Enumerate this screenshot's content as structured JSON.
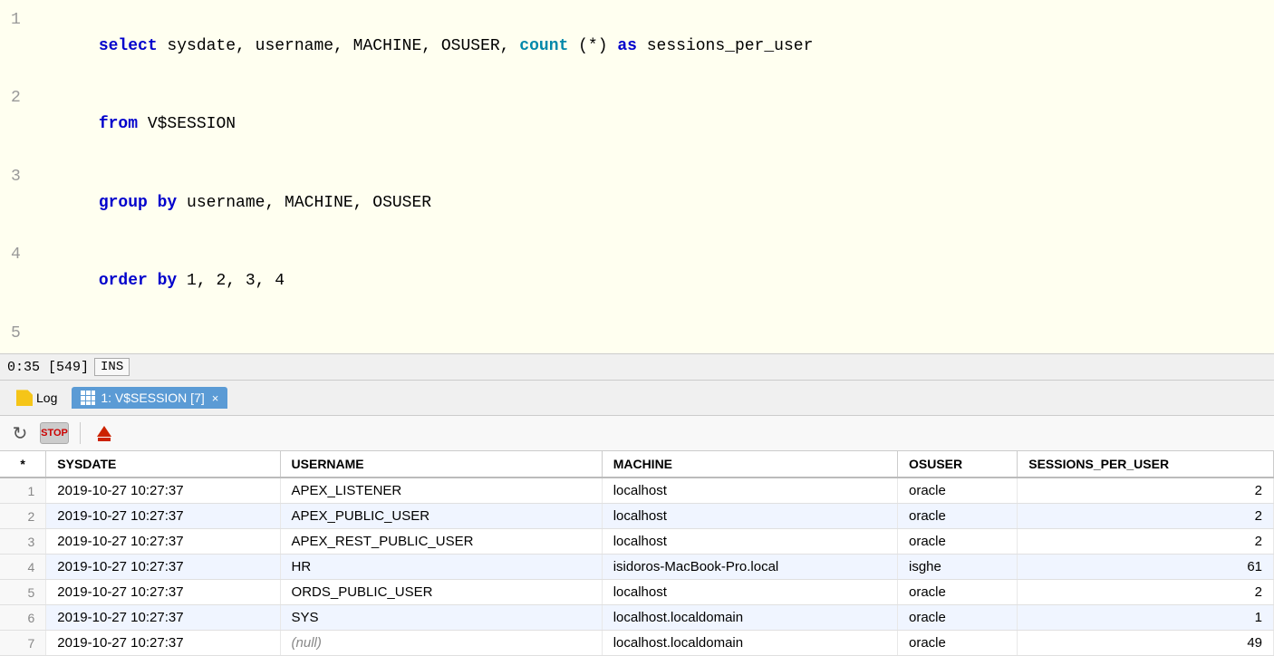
{
  "editor": {
    "lines": [
      {
        "number": "1",
        "segments": [
          {
            "text": "select",
            "class": "kw-blue"
          },
          {
            "text": " sysdate, username, MACHINE, OSUSER, ",
            "class": "normal"
          },
          {
            "text": "count",
            "class": "kw-cyan"
          },
          {
            "text": " (*) ",
            "class": "normal"
          },
          {
            "text": "as",
            "class": "kw-blue"
          },
          {
            "text": " sessions_per_user",
            "class": "normal"
          }
        ]
      },
      {
        "number": "2",
        "segments": [
          {
            "text": "from",
            "class": "kw-blue"
          },
          {
            "text": " V$SESSION",
            "class": "normal"
          }
        ]
      },
      {
        "number": "3",
        "segments": [
          {
            "text": "group by",
            "class": "kw-blue"
          },
          {
            "text": " username, MACHINE, OSUSER",
            "class": "normal"
          }
        ]
      },
      {
        "number": "4",
        "segments": [
          {
            "text": "order by",
            "class": "kw-blue"
          },
          {
            "text": " 1, 2, 3, 4",
            "class": "normal"
          }
        ]
      },
      {
        "number": "5",
        "segments": [
          {
            "text": "",
            "class": "normal"
          }
        ]
      }
    ]
  },
  "statusBar": {
    "text": "0:35 [549]",
    "badge": "INS"
  },
  "tabs": {
    "logLabel": "Log",
    "activeTab": "1: V$SESSION [7]",
    "closeLabel": "×"
  },
  "toolbar": {
    "refreshLabel": "↻",
    "stopLabel": "STOP"
  },
  "table": {
    "columns": [
      "*",
      "SYSDATE",
      "USERNAME",
      "MACHINE",
      "OSUSER",
      "SESSIONS_PER_USER"
    ],
    "rows": [
      {
        "rownum": "1",
        "sysdate": "2019-10-27 10:27:37",
        "username": "APEX_LISTENER",
        "machine": "localhost",
        "osuser": "oracle",
        "sessions": "2"
      },
      {
        "rownum": "2",
        "sysdate": "2019-10-27 10:27:37",
        "username": "APEX_PUBLIC_USER",
        "machine": "localhost",
        "osuser": "oracle",
        "sessions": "2"
      },
      {
        "rownum": "3",
        "sysdate": "2019-10-27 10:27:37",
        "username": "APEX_REST_PUBLIC_USER",
        "machine": "localhost",
        "osuser": "oracle",
        "sessions": "2"
      },
      {
        "rownum": "4",
        "sysdate": "2019-10-27 10:27:37",
        "username": "HR",
        "machine": "isidoros-MacBook-Pro.local",
        "osuser": "isghe",
        "sessions": "61"
      },
      {
        "rownum": "5",
        "sysdate": "2019-10-27 10:27:37",
        "username": "ORDS_PUBLIC_USER",
        "machine": "localhost",
        "osuser": "oracle",
        "sessions": "2"
      },
      {
        "rownum": "6",
        "sysdate": "2019-10-27 10:27:37",
        "username": "SYS",
        "machine": "localhost.localdomain",
        "osuser": "oracle",
        "sessions": "1"
      },
      {
        "rownum": "7",
        "sysdate": "2019-10-27 10:27:37",
        "username": "(null)",
        "machine": "localhost.localdomain",
        "osuser": "oracle",
        "sessions": "49"
      }
    ]
  }
}
